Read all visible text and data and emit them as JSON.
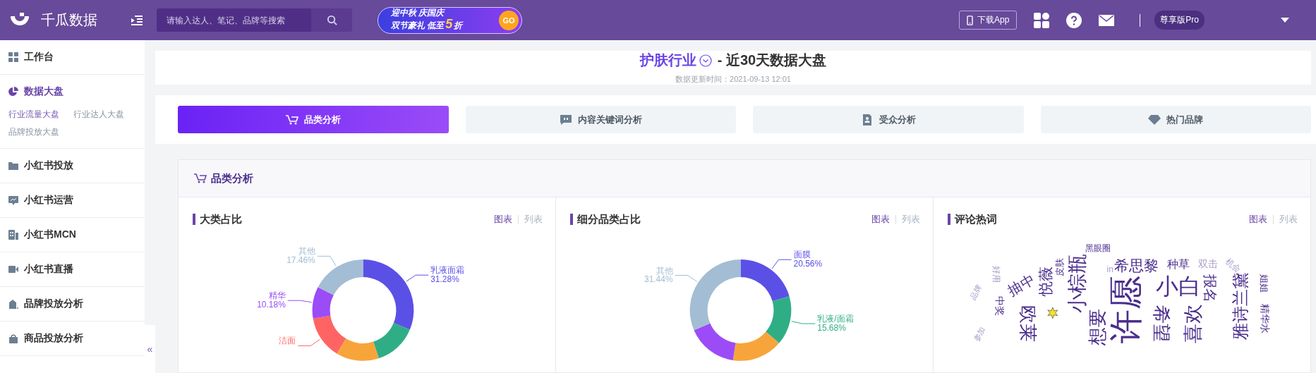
{
  "header": {
    "logo_text": "千瓜数据",
    "search": {
      "placeholder": "请输入达人、笔记、品牌等搜索"
    },
    "banner": {
      "line1": "迎中秋 庆国庆",
      "line2": "双节豪礼 低至",
      "number": "5",
      "unit": "折",
      "go": "GO"
    },
    "download": "下载App",
    "plan": "尊享版Pro"
  },
  "sidebar": {
    "items": [
      {
        "label": "工作台",
        "selected": false
      },
      {
        "label": "数据大盘",
        "selected": true,
        "children": [
          {
            "label": "行业流量大盘",
            "selected": true
          },
          {
            "label": "行业达人大盘",
            "selected": false
          },
          {
            "label": "品牌投放大盘",
            "selected": false
          }
        ]
      },
      {
        "label": "小红书投放",
        "selected": false
      },
      {
        "label": "小红书运营",
        "selected": false
      },
      {
        "label": "小红书MCN",
        "selected": false
      },
      {
        "label": "小红书直播",
        "selected": false
      },
      {
        "label": "品牌投放分析",
        "selected": false
      },
      {
        "label": "商品投放分析",
        "selected": false
      }
    ],
    "collapse": "«"
  },
  "page_title": {
    "industry": "护肤行业",
    "suffix": "- 近30天数据大盘",
    "updated": "数据更新时间：2021-09-13 12:01"
  },
  "tabs": [
    {
      "label": "品类分析",
      "selected": true
    },
    {
      "label": "内容关键词分析",
      "selected": false
    },
    {
      "label": "受众分析",
      "selected": false
    },
    {
      "label": "热门品牌",
      "selected": false
    }
  ],
  "section": {
    "title": "品类分析",
    "panels": [
      {
        "title": "大类占比",
        "toggles": [
          {
            "label": "图表",
            "selected": true
          },
          {
            "label": "列表",
            "selected": false
          }
        ],
        "donut": [
          {
            "label": "乳液面霜",
            "value_label": "31.28%",
            "color": "#5a50e6"
          },
          {
            "color": "#2fae86"
          },
          {
            "color": "#f7a53b"
          },
          {
            "label": "洁面",
            "color": "#ff6464"
          },
          {
            "label": "精华",
            "value_label": "10.18%",
            "color": "#9b4cf6"
          },
          {
            "label": "其他",
            "value_label": "17.46%",
            "color": "#a3bdd4"
          }
        ]
      },
      {
        "title": "细分品类占比",
        "toggles": [
          {
            "label": "图表",
            "selected": true
          },
          {
            "label": "列表",
            "selected": false
          }
        ],
        "donut": [
          {
            "label": "面膜",
            "value_label": "20.56%",
            "color": "#5a50e6"
          },
          {
            "label": "乳液/面霜",
            "value_label": "15.68%",
            "color": "#2fae86"
          },
          {
            "color": "#f7a53b"
          },
          {
            "color": "#9b4cf6"
          },
          {
            "label": "其他",
            "value_label": "31.44%",
            "color": "#a3bdd4"
          }
        ]
      },
      {
        "title": "评论热词",
        "toggles": [
          {
            "label": "图表",
            "selected": true
          },
          {
            "label": "列表",
            "selected": false
          }
        ],
        "words": [
          "黑眼圈",
          "希思黎",
          "种草",
          "双击",
          "机会",
          "皮肤",
          "悦薇",
          "小棕瓶",
          "小白",
          "报名",
          "雅诗兰黛",
          "姐姐",
          "精华水",
          "许愿",
          "希望",
          "喜欢",
          "想要",
          "欧莱",
          "抽中",
          "中奖",
          "好用",
          "品牌",
          "参加",
          "in"
        ]
      }
    ]
  }
}
